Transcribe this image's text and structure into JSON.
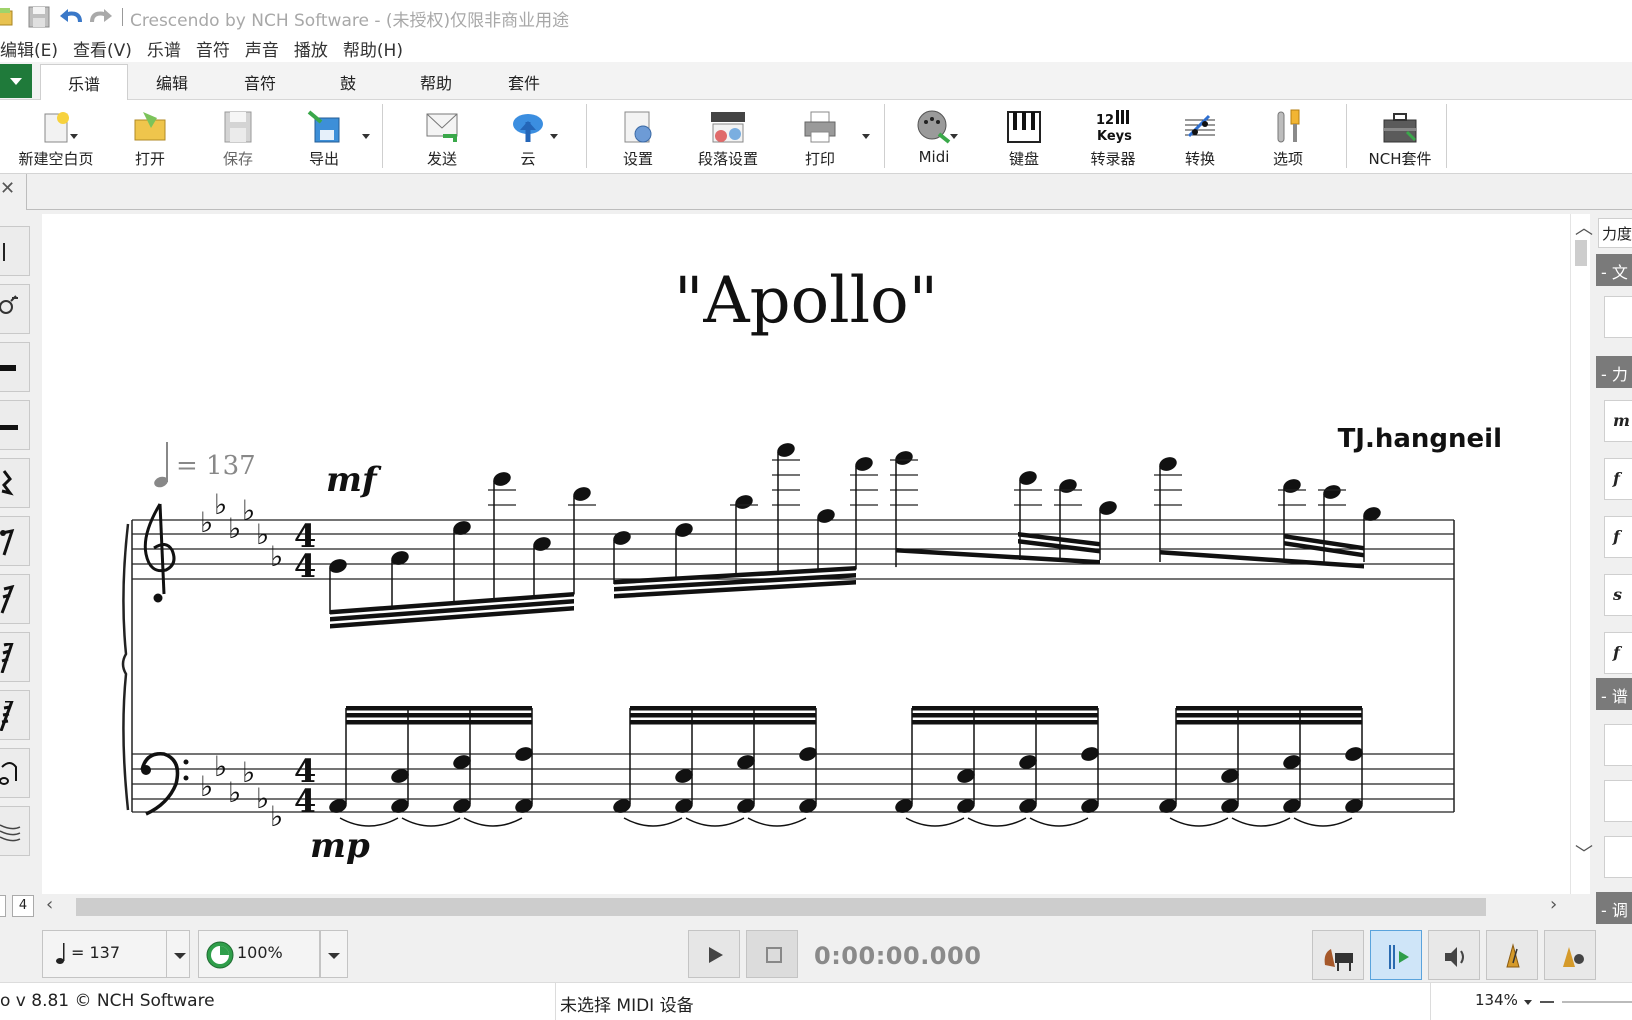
{
  "window": {
    "title": "Crescendo by NCH Software - (未授权)仅限非商业用途"
  },
  "menu": [
    "编辑(E)",
    "查看(V)",
    "乐谱",
    "音符",
    "声音",
    "播放",
    "帮助(H)"
  ],
  "ribbon_tabs": [
    "乐谱",
    "编辑",
    "音符",
    "鼓",
    "帮助",
    "套件"
  ],
  "ribbon_buttons": {
    "new_page": "新建空白页",
    "open": "打开",
    "save": "保存",
    "export": "导出",
    "send": "发送",
    "cloud": "云",
    "settings": "设置",
    "section_settings": "段落设置",
    "print": "打印",
    "midi": "Midi",
    "keyboard": "键盘",
    "transcriber": "转录器",
    "convert": "转换",
    "options": "选项",
    "nch_suite": "NCH套件"
  },
  "icons": {
    "keys_line1": "12",
    "keys_line2": "Keys"
  },
  "score": {
    "title": "\"Apollo\"",
    "composer": "TJ.hangneil",
    "tempo_value": "= 137",
    "dynamic_treble": "mf",
    "dynamic_bass": "mp",
    "time_sig_top": "4",
    "time_sig_bottom": "4"
  },
  "page_number": "4",
  "right_panel": {
    "force_tab": "力度",
    "sections": [
      "文",
      "力",
      "谱",
      "调"
    ],
    "dynamics": [
      "m",
      "f",
      "f",
      "s",
      "f"
    ]
  },
  "transport": {
    "tempo": "= 137",
    "speed": "100%",
    "time": "0:00:00.000"
  },
  "status": {
    "left": "o v 8.81 © NCH Software",
    "midi": "未选择 MIDI 设备",
    "zoom": "134%"
  },
  "colors": {
    "accent_green": "#1f7a3a",
    "active_blue": "#cfe5f8",
    "section_gray": "#7a7a7a"
  }
}
